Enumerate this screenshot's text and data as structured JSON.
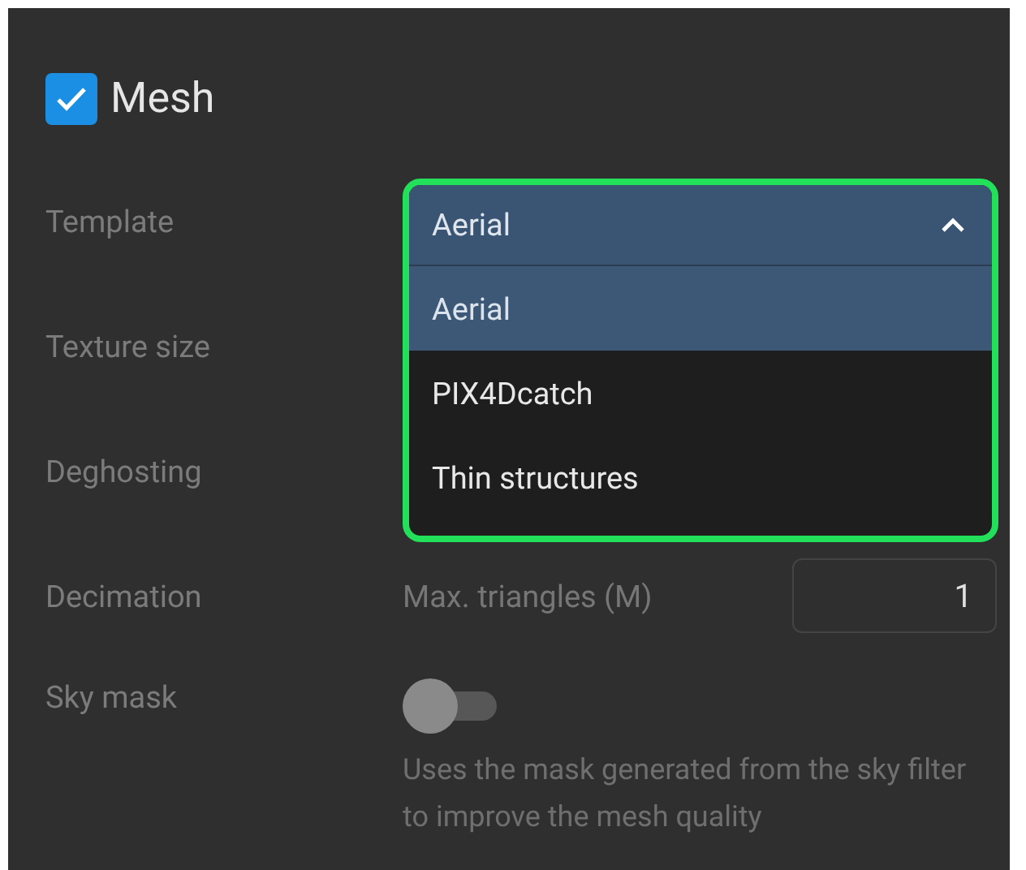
{
  "section": {
    "title": "Mesh",
    "checked": true
  },
  "template": {
    "label": "Template",
    "value": "Aerial",
    "expanded": true,
    "options": [
      {
        "label": "Aerial",
        "selected": true
      },
      {
        "label": "PIX4Dcatch",
        "selected": false
      },
      {
        "label": "Thin structures",
        "selected": false
      }
    ]
  },
  "hidden_labels": [
    "Texture size",
    "Deghosting"
  ],
  "decimation": {
    "label": "Decimation",
    "field_label": "Max. triangles (M)",
    "value": "1"
  },
  "sky_mask": {
    "label": "Sky mask",
    "on": false,
    "description": "Uses the mask generated from the sky filter to improve the mesh quality"
  }
}
